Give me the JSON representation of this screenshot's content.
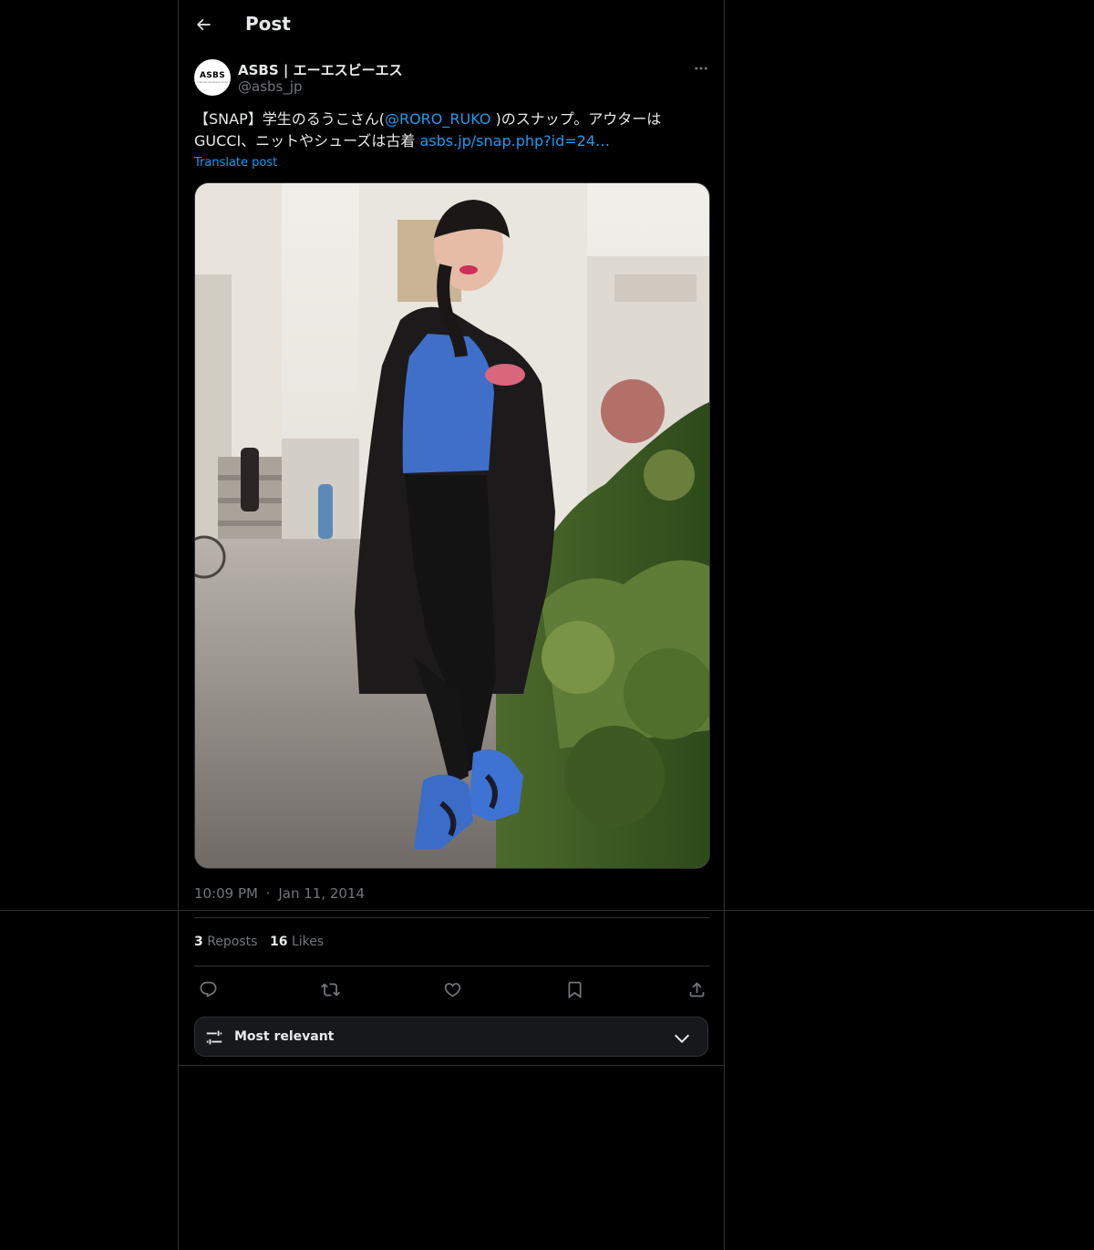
{
  "header": {
    "title": "Post"
  },
  "author": {
    "name": "ASBS | エーエスビーエス",
    "handle": "@asbs_jp",
    "avatar_text": "ASBS",
    "avatar_sub": "a street boutique snap"
  },
  "tweet": {
    "text_part1": "【SNAP】学生のるうこさん(",
    "mention": "@RORO_RUKO",
    "text_part2": " )のスナップ。アウターは GUCCI、ニットやシューズは古着 ",
    "link": "asbs.jp/snap.php?id=24…",
    "translate": "Translate post",
    "time": "10:09 PM",
    "separator": "·",
    "date": "Jan 11, 2014"
  },
  "stats": {
    "reposts_count": "3",
    "reposts_label": "Reposts",
    "likes_count": "16",
    "likes_label": "Likes"
  },
  "actions": [
    "reply-icon",
    "repost-icon",
    "like-icon",
    "bookmark-icon",
    "share-icon"
  ],
  "replies_sort": {
    "label": "Most relevant"
  },
  "colors": {
    "background": "#000000",
    "text": "#e7e9ea",
    "secondary": "#71767b",
    "accent": "#1d9bf0",
    "border": "#2f3336"
  }
}
